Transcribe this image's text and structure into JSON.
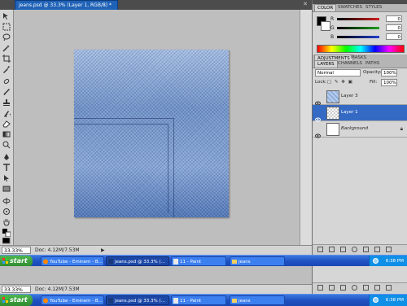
{
  "document": {
    "tab_title": "jeans.psd @ 33.3% (Layer 1, RGB/8) *",
    "zoom": "33.33%",
    "doc_info": "Doc: 4.12M/7.53M"
  },
  "color_panel": {
    "tabs": [
      "COLOR",
      "SWATCHES",
      "STYLES"
    ],
    "channels": [
      {
        "label": "R",
        "value": "0",
        "color": "#d02020"
      },
      {
        "label": "G",
        "value": "0",
        "color": "#20a020"
      },
      {
        "label": "B",
        "value": "0",
        "color": "#2040d0"
      }
    ]
  },
  "adjustments_panel": {
    "tabs": [
      "ADJUSTMENTS",
      "MASKS"
    ]
  },
  "layers_panel": {
    "tabs": [
      "LAYERS",
      "CHANNELS",
      "PATHS"
    ],
    "blend_mode": "Normal",
    "opacity_label": "Opacity:",
    "opacity_value": "100%",
    "lock_label": "Lock:",
    "fill_label": "Fill:",
    "fill_value": "100%",
    "layers": [
      {
        "name": "Layer 3",
        "selected": false
      },
      {
        "name": "Layer 1",
        "selected": true
      },
      {
        "name": "Background",
        "selected": false
      }
    ]
  },
  "taskbar": {
    "start_label": "start",
    "buttons": [
      {
        "label": "YouTube - Eminem - B...",
        "active": false
      },
      {
        "label": "jeans.psd @ 33.3% (...",
        "active": true
      },
      {
        "label": "11 - Paint",
        "active": false
      },
      {
        "label": "jeans",
        "active": false
      }
    ],
    "time": "6:38 PM"
  },
  "lower_taskbar": {
    "start_label": "start",
    "buttons": [
      {
        "label": "YouTube - Eminem - B...",
        "active": false
      },
      {
        "label": "jeans.psd @ 33.3% (...",
        "active": true
      },
      {
        "label": "11 - Paint",
        "active": false
      },
      {
        "label": "jeans",
        "active": false
      }
    ],
    "time": "6:38 PM"
  },
  "lower_status": {
    "zoom": "33.33%",
    "doc_info": "Doc: 4.12M/7.53M"
  }
}
